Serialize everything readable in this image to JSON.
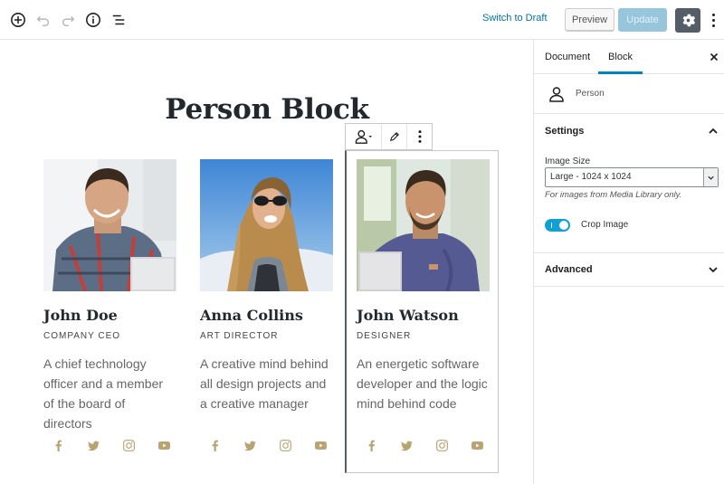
{
  "toolbar": {
    "add_icon": "plus-circle-icon",
    "undo_icon": "undo-icon",
    "redo_icon": "redo-icon",
    "info_icon": "info-icon",
    "outline_icon": "list-outline-icon",
    "switch_to_draft": "Switch to Draft",
    "preview": "Preview",
    "update": "Update",
    "settings_icon": "gear-icon",
    "more_icon": "more-vertical-icon"
  },
  "editor": {
    "title": "Person Block",
    "block_toolbar": {
      "block_type_icon": "person-icon",
      "edit_icon": "pencil-icon",
      "more_icon": "more-vertical-icon"
    },
    "people": [
      {
        "name": "John Doe",
        "role": "Company CEO",
        "description": " A chief technology officer and a member of the board of directors",
        "socials": [
          "facebook-icon",
          "twitter-icon",
          "instagram-icon",
          "youtube-icon"
        ]
      },
      {
        "name": "Anna Collins",
        "role": "Art Director",
        "description": " A creative mind behind all design projects and a creative manager",
        "socials": [
          "facebook-icon",
          "twitter-icon",
          "instagram-icon",
          "youtube-icon"
        ]
      },
      {
        "name": "John Watson",
        "role": "Designer",
        "description": "An energetic software developer and the logic mind behind code",
        "socials": [
          "facebook-icon",
          "twitter-icon",
          "instagram-icon",
          "youtube-icon"
        ]
      }
    ]
  },
  "sidebar": {
    "tabs": [
      {
        "label": "Document",
        "active": false
      },
      {
        "label": "Block",
        "active": true
      }
    ],
    "block_name": "Person",
    "settings": {
      "title": "Settings",
      "image_size_label": "Image Size",
      "image_size_value": "Large - 1024 x 1024",
      "image_size_help": "For images from Media Library only.",
      "crop_image_label": "Crop Image",
      "crop_image_on": true
    },
    "advanced": {
      "title": "Advanced"
    }
  },
  "colors": {
    "accent": "#0085ba",
    "update_disabled": "#96c5dc",
    "gear_bg": "#555d66",
    "social": "#b8a373",
    "toggle_on": "#11a0d2"
  }
}
